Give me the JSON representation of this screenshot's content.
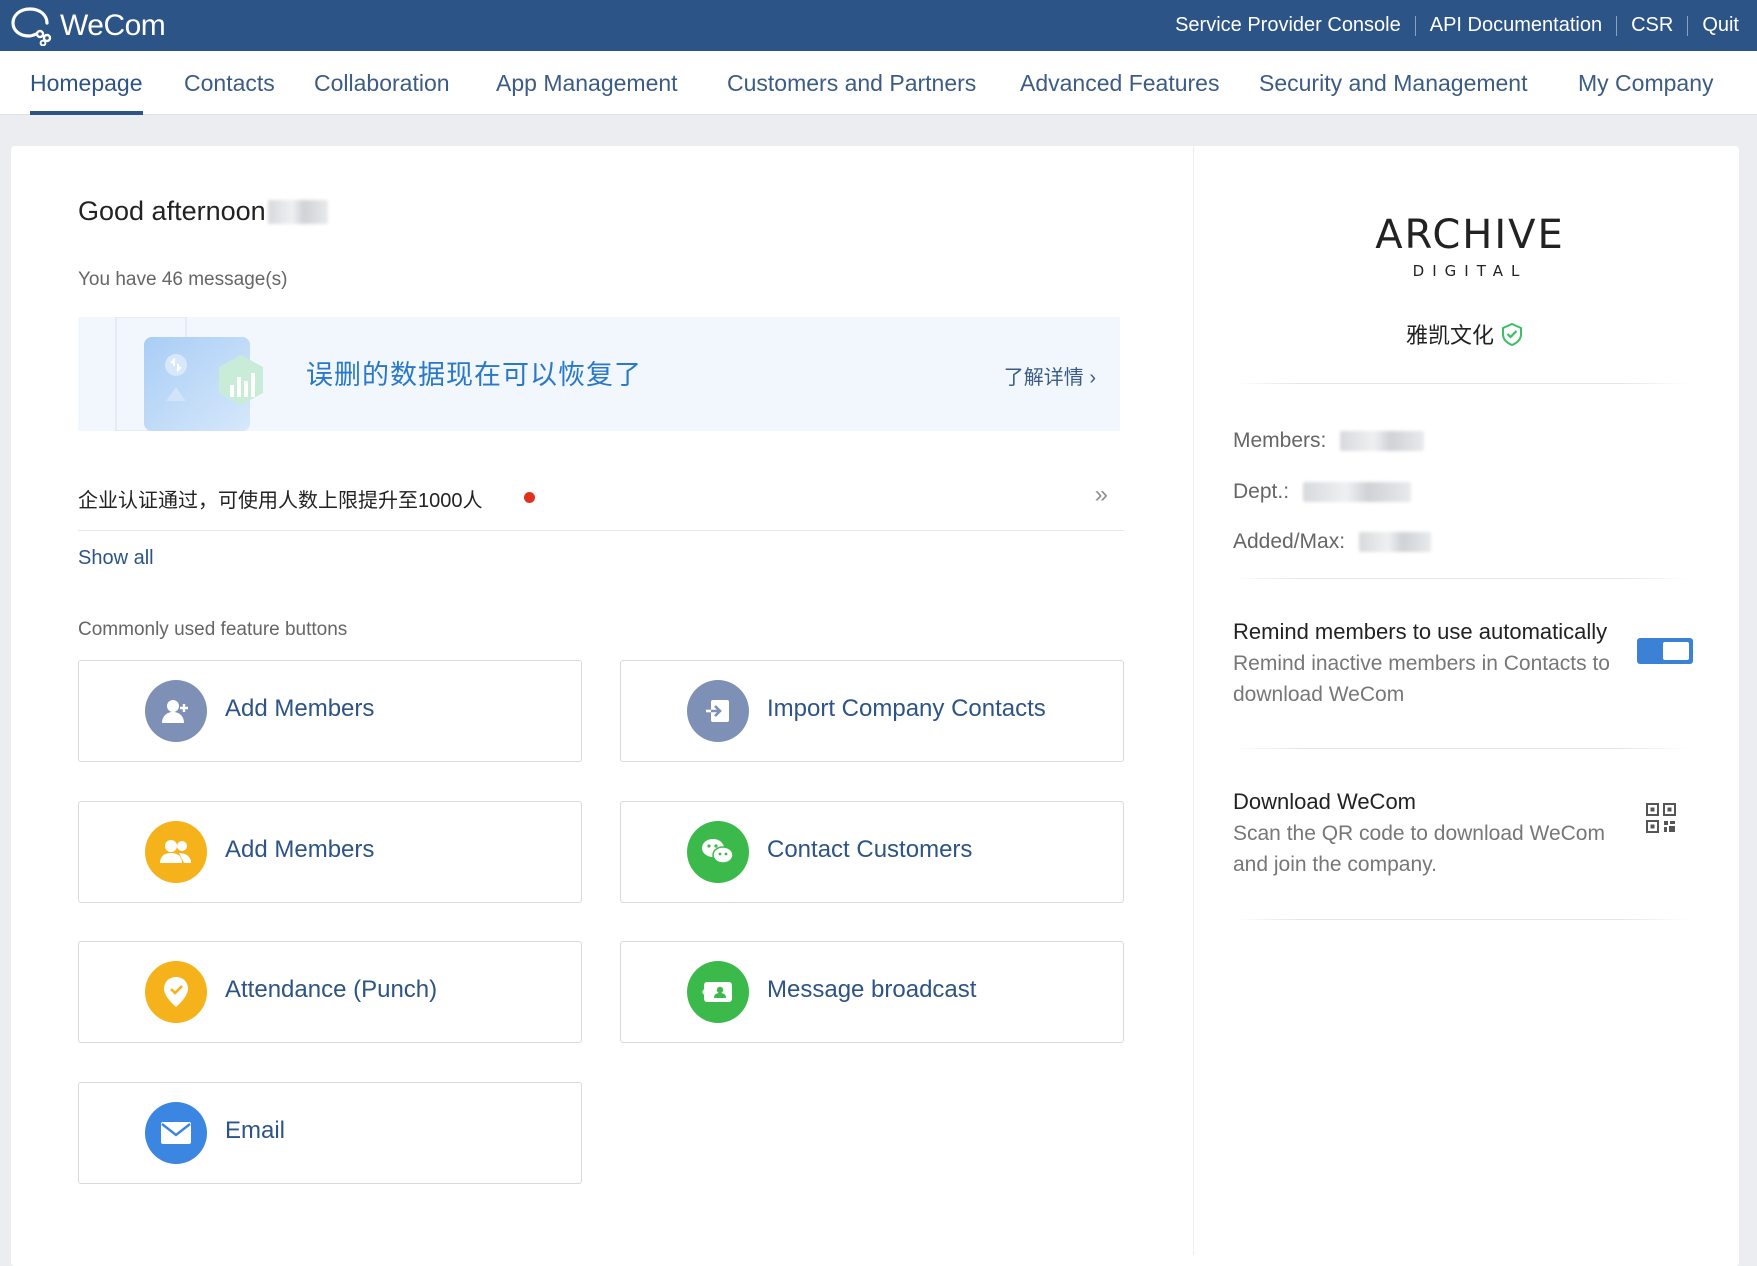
{
  "app": {
    "name": "WeCom"
  },
  "topbar": {
    "links": [
      "Service Provider Console",
      "API Documentation",
      "CSR",
      "Quit"
    ]
  },
  "nav": {
    "tabs": [
      "Homepage",
      "Contacts",
      "Collaboration",
      "App Management",
      "Customers and Partners",
      "Advanced Features",
      "Security and Management",
      "My Company"
    ],
    "active": "Homepage"
  },
  "main": {
    "greeting": "Good afternoon",
    "messages": "You have 46 message(s)",
    "banner": {
      "text": "误删的数据现在可以恢复了",
      "link": "了解详情 ›"
    },
    "notice": {
      "text": "企业认证通过，可使用人数上限提升至1000人",
      "arrow": "»"
    },
    "show_all": "Show all",
    "features_title": "Commonly used feature buttons",
    "features": [
      {
        "label": "Add Members",
        "icon": "add-user-icon",
        "color": "#7e90b6"
      },
      {
        "label": "Import Company Contacts",
        "icon": "import-icon",
        "color": "#7e90b6"
      },
      {
        "label": "Add Members",
        "icon": "group-icon",
        "color": "#f6b21b"
      },
      {
        "label": "Contact Customers",
        "icon": "wechat-icon",
        "color": "#3cb94b"
      },
      {
        "label": "Attendance (Punch)",
        "icon": "location-check-icon",
        "color": "#f6b21b"
      },
      {
        "label": "Message broadcast",
        "icon": "broadcast-icon",
        "color": "#3cb94b"
      },
      {
        "label": "Email",
        "icon": "mail-icon",
        "color": "#3b86e0"
      }
    ]
  },
  "company": {
    "logo_main": "ARCHIVE",
    "logo_sub": "DIGITAL",
    "name": "雅凯文化",
    "members_label": "Members:",
    "dept_label": "Dept.:",
    "added_label": "Added/Max:"
  },
  "options": {
    "remind_title": "Remind members to use automatically",
    "remind_desc_1": "Remind inactive members in Contacts to",
    "remind_desc_2": "download WeCom",
    "remind_enabled": true,
    "download_title": "Download WeCom",
    "download_desc_1": "Scan the QR code to download WeCom",
    "download_desc_2": "and join the company."
  },
  "colors": {
    "brand": "#2d5486",
    "accent": "#2a78c8",
    "toggle": "#3b82d6",
    "verified": "#3cbf63"
  }
}
